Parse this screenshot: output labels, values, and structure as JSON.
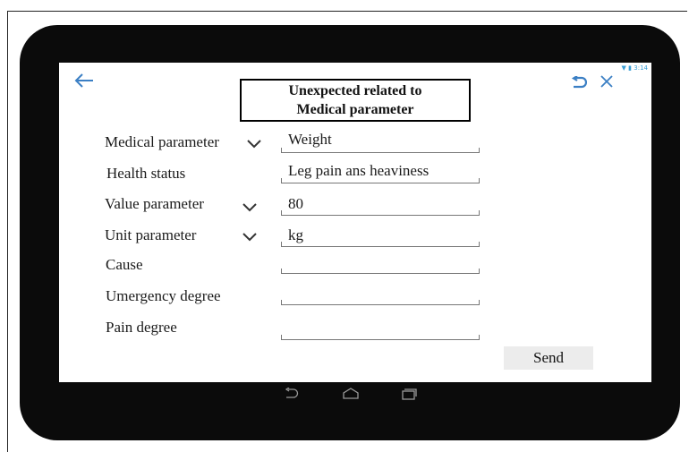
{
  "status_bar": {
    "time": "3:14"
  },
  "header": {
    "title_line1": "Unexpected  related to",
    "title_line2": "Medical parameter"
  },
  "form": {
    "rows": [
      {
        "label": "Medical parameter",
        "value": "Weight",
        "has_dropdown": true
      },
      {
        "label": "Health status",
        "value": "Leg pain ans heaviness",
        "has_dropdown": false
      },
      {
        "label": "Value parameter",
        "value": "80",
        "has_dropdown": true
      },
      {
        "label": "Unit parameter",
        "value": "kg",
        "has_dropdown": true
      },
      {
        "label": "Cause",
        "value": "",
        "has_dropdown": false
      },
      {
        "label": "Umergency degree",
        "value": "",
        "has_dropdown": false
      },
      {
        "label": "Pain degree",
        "value": "",
        "has_dropdown": false
      }
    ],
    "send_label": "Send"
  },
  "icons": {
    "back": "back-arrow-icon",
    "undo": "undo-icon",
    "close": "close-icon",
    "nav_back": "nav-back-icon",
    "nav_home": "nav-home-icon",
    "nav_recents": "nav-recents-icon",
    "chevron": "chevron-down-icon"
  },
  "colors": {
    "accent": "#3b7fc4",
    "tablet_bezel": "#0b0b0b",
    "status_icons": "#3b9fd6"
  }
}
